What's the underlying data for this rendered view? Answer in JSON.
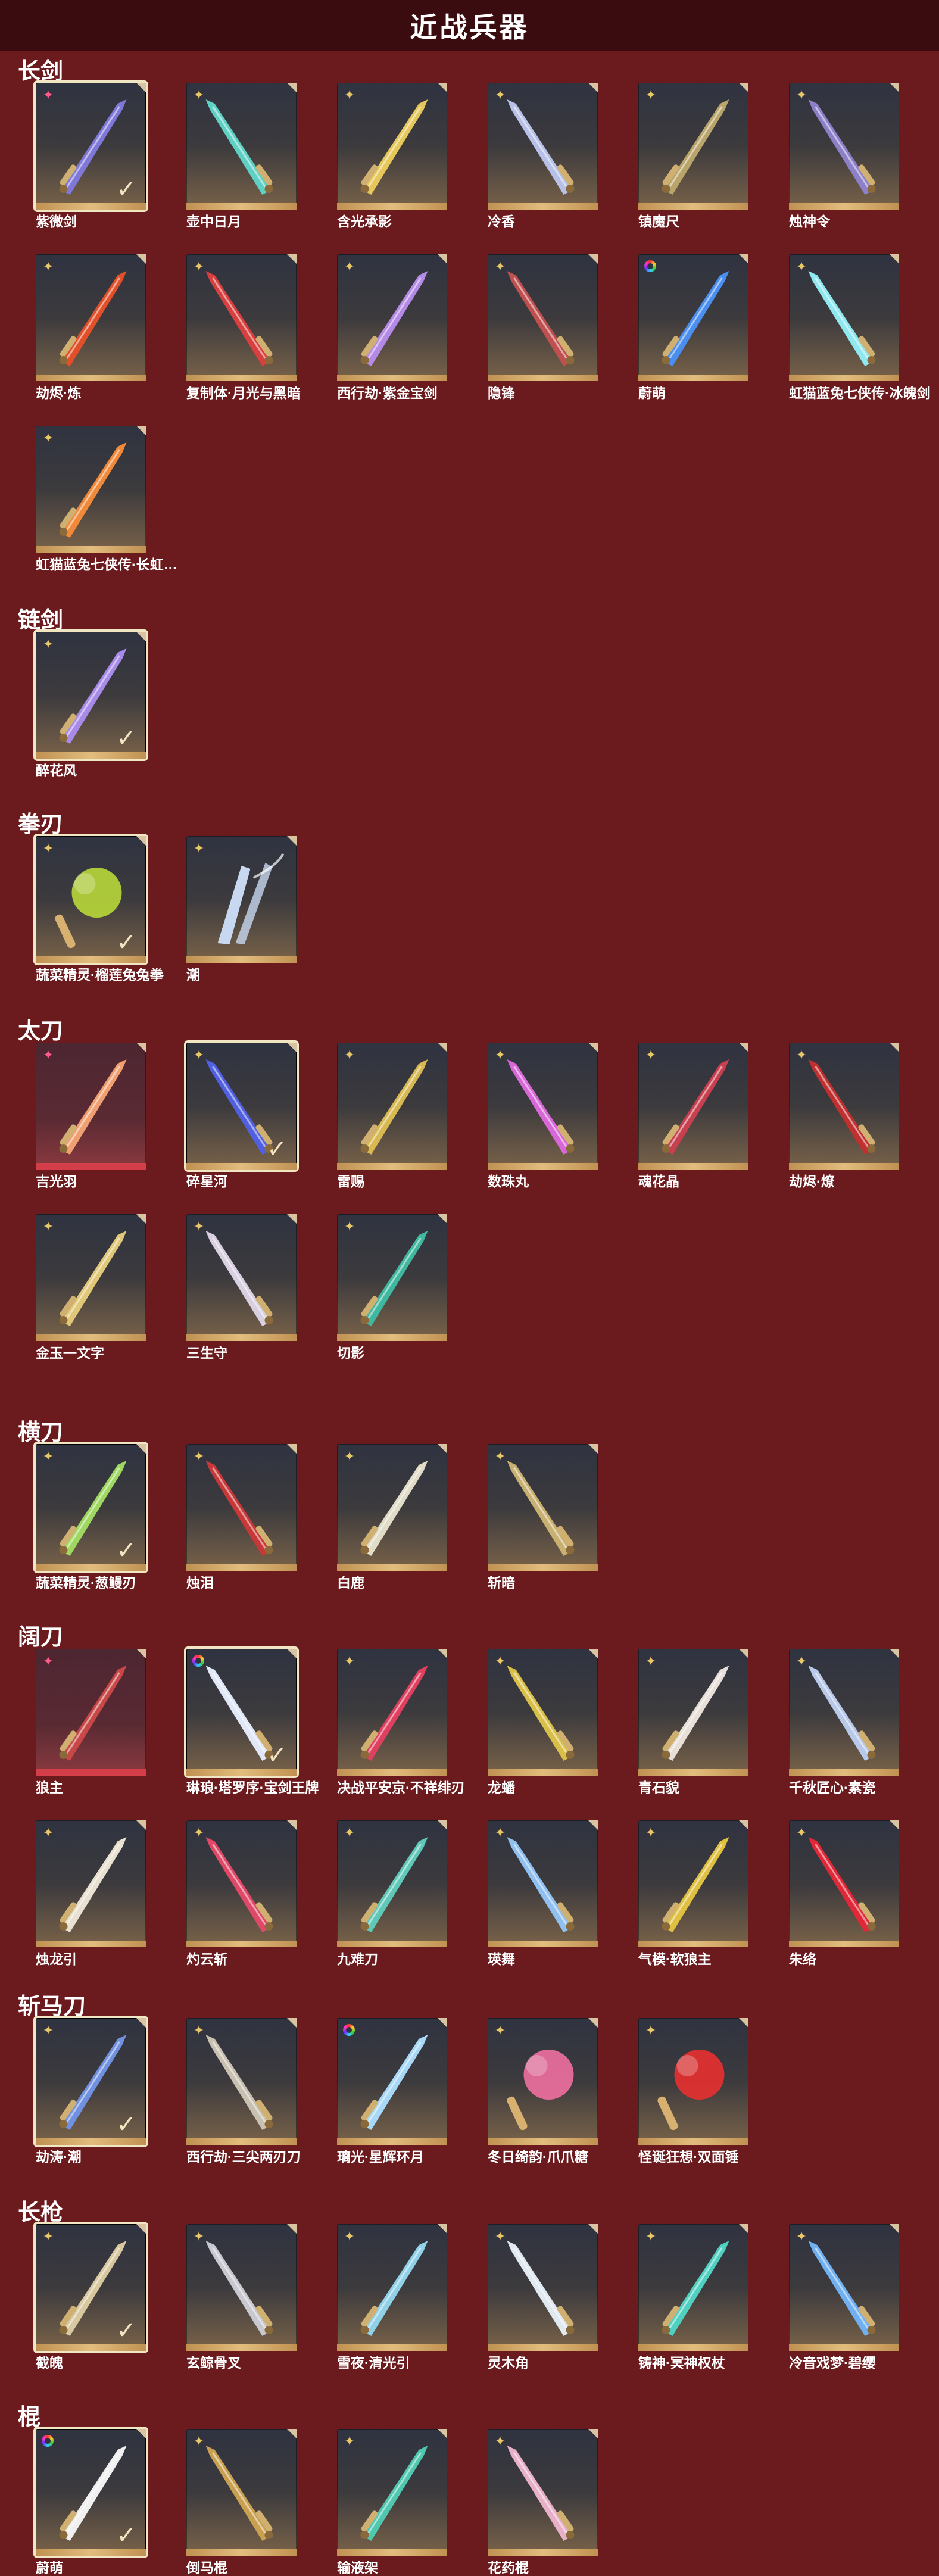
{
  "header": {
    "title": "近战兵器"
  },
  "sections": [
    {
      "title": "长剑",
      "items": [
        {
          "name": "紫微剑",
          "tag": "pink",
          "selected": true,
          "color": "#7f78d8",
          "shape": "sword"
        },
        {
          "name": "壶中日月",
          "tag": "gold",
          "selected": false,
          "color": "#5fd0c4",
          "shape": "sword"
        },
        {
          "name": "含光承影",
          "tag": "gold",
          "selected": false,
          "color": "#e6c85a",
          "shape": "sword"
        },
        {
          "name": "冷香",
          "tag": "gold",
          "selected": false,
          "color": "#b7c0e6",
          "shape": "sword"
        },
        {
          "name": "镇魔尺",
          "tag": "gold",
          "selected": false,
          "color": "#b9a46a",
          "shape": "sword"
        },
        {
          "name": "烛神令",
          "tag": "gold",
          "selected": false,
          "color": "#8d7fc8",
          "shape": "sword"
        },
        {
          "name": "劫烬·炼",
          "tag": "gold",
          "selected": false,
          "color": "#e2502a",
          "shape": "sword"
        },
        {
          "name": "复制体·月光与黑暗",
          "tag": "gold",
          "selected": false,
          "color": "#d84040",
          "shape": "sword"
        },
        {
          "name": "西行劫·紫金宝剑",
          "tag": "gold",
          "selected": false,
          "color": "#b48ae6",
          "shape": "sword"
        },
        {
          "name": "隐锋",
          "tag": "gold",
          "selected": false,
          "color": "#c05050",
          "shape": "sword"
        },
        {
          "name": "蔚萌",
          "tag": "rainbow",
          "selected": false,
          "color": "#4a8ef0",
          "shape": "sword"
        },
        {
          "name": "虹猫蓝兔七侠传·冰魄剑",
          "tag": "gold",
          "selected": false,
          "color": "#8fe8f0",
          "shape": "sword"
        },
        {
          "name": "虹猫蓝兔七侠传·长虹…",
          "tag": "gold",
          "selected": false,
          "color": "#f08a3a",
          "shape": "sword"
        }
      ]
    },
    {
      "title": "链剑",
      "items": [
        {
          "name": "醉花风",
          "tag": "gold",
          "selected": true,
          "color": "#a88ae8",
          "shape": "sword"
        }
      ]
    },
    {
      "title": "拳刃",
      "items": [
        {
          "name": "蔬菜精灵·榴莲兔兔拳",
          "tag": "gold",
          "selected": true,
          "color": "#b8d83a",
          "shape": "blob"
        },
        {
          "name": "潮",
          "tag": "gold",
          "selected": false,
          "color": "#c8d8f0",
          "shape": "claw"
        }
      ]
    },
    {
      "title": "太刀",
      "items": [
        {
          "name": "吉光羽",
          "tag": "pink",
          "selected": false,
          "red": true,
          "color": "#f0a070",
          "shape": "sword"
        },
        {
          "name": "碎星河",
          "tag": "gold",
          "selected": true,
          "color": "#5060e0",
          "shape": "sword"
        },
        {
          "name": "雷赐",
          "tag": "gold",
          "selected": false,
          "color": "#d8b850",
          "shape": "sword"
        },
        {
          "name": "数珠丸",
          "tag": "gold",
          "selected": false,
          "color": "#d868d8",
          "shape": "sword"
        },
        {
          "name": "魂花晶",
          "tag": "gold",
          "selected": false,
          "color": "#c84050",
          "shape": "sword"
        },
        {
          "name": "劫烬·燎",
          "tag": "gold",
          "selected": false,
          "color": "#c03030",
          "shape": "sword"
        },
        {
          "name": "金玉一文字",
          "tag": "gold",
          "selected": false,
          "color": "#e0c878",
          "shape": "sword"
        },
        {
          "name": "三生守",
          "tag": "gold",
          "selected": false,
          "color": "#d8d0e0",
          "shape": "sword"
        },
        {
          "name": "切影",
          "tag": "gold",
          "selected": false,
          "color": "#40b8a0",
          "shape": "sword"
        }
      ]
    },
    {
      "title": "横刀",
      "items": [
        {
          "name": "蔬菜精灵·葱鳗刃",
          "tag": "gold",
          "selected": true,
          "color": "#9ed860",
          "shape": "sword"
        },
        {
          "name": "烛泪",
          "tag": "gold",
          "selected": false,
          "color": "#c83838",
          "shape": "sword"
        },
        {
          "name": "白鹿",
          "tag": "gold",
          "selected": false,
          "color": "#e0dcc8",
          "shape": "sword"
        },
        {
          "name": "斩暗",
          "tag": "gold",
          "selected": false,
          "color": "#c8b070",
          "shape": "sword"
        }
      ]
    },
    {
      "title": "阔刀",
      "items": [
        {
          "name": "狼主",
          "tag": "pink",
          "selected": false,
          "red": true,
          "color": "#c84848",
          "shape": "sword"
        },
        {
          "name": "琳琅·塔罗序·宝剑王牌",
          "tag": "rainbow",
          "selected": true,
          "color": "#e0e8f8",
          "shape": "sword"
        },
        {
          "name": "决战平安京·不祥绯刃",
          "tag": "gold",
          "selected": false,
          "color": "#e04060",
          "shape": "sword"
        },
        {
          "name": "龙蟠",
          "tag": "gold",
          "selected": false,
          "color": "#d8c048",
          "shape": "sword"
        },
        {
          "name": "青石貌",
          "tag": "gold",
          "selected": false,
          "color": "#e8e0d8",
          "shape": "sword"
        },
        {
          "name": "千秋匠心·素瓷",
          "tag": "gold",
          "selected": false,
          "color": "#b8c8e8",
          "shape": "sword"
        },
        {
          "name": "烛龙引",
          "tag": "gold",
          "selected": false,
          "color": "#e8e0d0",
          "shape": "sword"
        },
        {
          "name": "灼云斩",
          "tag": "gold",
          "selected": false,
          "color": "#e04868",
          "shape": "sword"
        },
        {
          "name": "九难刀",
          "tag": "gold",
          "selected": false,
          "color": "#60c8b8",
          "shape": "sword"
        },
        {
          "name": "瑛舞",
          "tag": "gold",
          "selected": false,
          "color": "#90c0f0",
          "shape": "sword"
        },
        {
          "name": "气模·软狼主",
          "tag": "gold",
          "selected": false,
          "color": "#e0c040",
          "shape": "sword"
        },
        {
          "name": "朱络",
          "tag": "gold",
          "selected": false,
          "color": "#e02838",
          "shape": "sword"
        }
      ]
    },
    {
      "title": "斩马刀",
      "items": [
        {
          "name": "劫涛·潮",
          "tag": "gold",
          "selected": true,
          "color": "#7090e0",
          "shape": "sword"
        },
        {
          "name": "西行劫·三尖两刃刀",
          "tag": "gold",
          "selected": false,
          "color": "#c8c0b0",
          "shape": "sword"
        },
        {
          "name": "璃光·星辉环月",
          "tag": "rainbow",
          "selected": false,
          "color": "#a8d8f8",
          "shape": "sword"
        },
        {
          "name": "冬日绮韵·爪爪糖",
          "tag": "gold",
          "selected": false,
          "color": "#f070a0",
          "shape": "blob"
        },
        {
          "name": "怪诞狂想·双面锤",
          "tag": "gold",
          "selected": false,
          "color": "#e83030",
          "shape": "blob"
        }
      ]
    },
    {
      "title": "长枪",
      "items": [
        {
          "name": "截魄",
          "tag": "gold",
          "selected": true,
          "color": "#d8c8a0",
          "shape": "sword"
        },
        {
          "name": "玄鲸骨叉",
          "tag": "gold",
          "selected": false,
          "color": "#c8c8d0",
          "shape": "sword"
        },
        {
          "name": "雪夜·清光引",
          "tag": "gold",
          "selected": false,
          "color": "#90d0e8",
          "shape": "sword"
        },
        {
          "name": "灵木角",
          "tag": "gold",
          "selected": false,
          "color": "#e0e8f0",
          "shape": "sword"
        },
        {
          "name": "铸神·冥神权杖",
          "tag": "gold",
          "selected": false,
          "color": "#50d0c0",
          "shape": "sword"
        },
        {
          "name": "冷音戏梦·碧缨",
          "tag": "gold",
          "selected": false,
          "color": "#70b0f0",
          "shape": "sword"
        }
      ]
    },
    {
      "title": "棍",
      "items": [
        {
          "name": "蔚萌",
          "tag": "rainbow",
          "selected": true,
          "color": "#f0f0f0",
          "shape": "sword"
        },
        {
          "name": "倒马棍",
          "tag": "gold",
          "selected": false,
          "color": "#c8a050",
          "shape": "sword"
        },
        {
          "name": "输液架",
          "tag": "gold",
          "selected": false,
          "color": "#50c8b0",
          "shape": "sword"
        },
        {
          "name": "花药棍",
          "tag": "gold",
          "selected": false,
          "color": "#e8b0c8",
          "shape": "sword"
        }
      ]
    }
  ]
}
